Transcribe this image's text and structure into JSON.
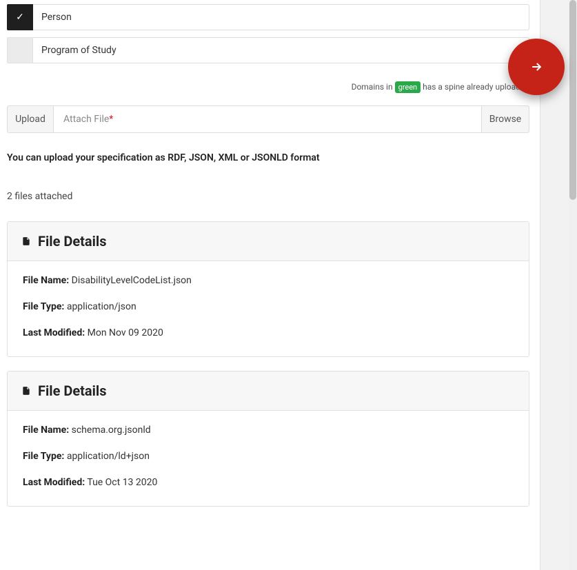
{
  "domains": [
    {
      "label": "Person",
      "selected": true
    },
    {
      "label": "Program of Study",
      "selected": false
    }
  ],
  "hint": {
    "prefix": "Domains in",
    "badge": "green",
    "suffix": "has a spine already uploaded"
  },
  "upload": {
    "label": "Upload",
    "placeholder": "Attach File",
    "browse": "Browse"
  },
  "info_text": "You can upload your specification as RDF, JSON, XML or JSONLD format",
  "attached_count": "2 files attached",
  "header_title": "File Details",
  "labels": {
    "file_name": "File Name:",
    "file_type": "File Type:",
    "last_modified": "Last Modified:"
  },
  "files": [
    {
      "name": "DisabilityLevelCodeList.json",
      "type": "application/json",
      "modified": "Mon Nov 09 2020"
    },
    {
      "name": "schema.org.jsonld",
      "type": "application/ld+json",
      "modified": "Tue Oct 13 2020"
    }
  ]
}
